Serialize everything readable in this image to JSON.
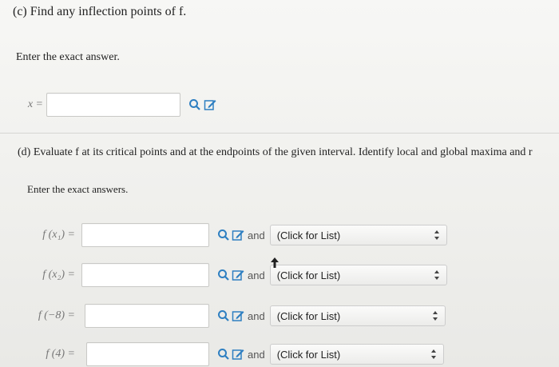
{
  "part_c": {
    "title": "(c) Find any inflection points of f.",
    "instruction": "Enter the exact answer.",
    "answer": {
      "lhs": "x =",
      "value": ""
    }
  },
  "part_d": {
    "title": "(d) Evaluate f at its critical points and at the endpoints of the given interval. Identify local and global maxima and r",
    "instruction": "Enter the exact answers.",
    "rows": [
      {
        "lhs": "f (x₁) =",
        "and": "and",
        "select": "(Click for List)"
      },
      {
        "lhs": "f (x₂) =",
        "and": "and",
        "select": "(Click for List)"
      },
      {
        "lhs": "f (−8) =",
        "and": "and",
        "select": "(Click for List)"
      },
      {
        "lhs": "f (4) =",
        "and": "and",
        "select": "(Click for List)"
      }
    ]
  },
  "icons": {
    "preview": "magnifier-icon",
    "edit": "edit-pencil-icon",
    "select_arrows": "up-down-arrows-icon"
  },
  "colors": {
    "icon_blue": "#2e7fc1",
    "box_border": "#c9c9c6"
  }
}
